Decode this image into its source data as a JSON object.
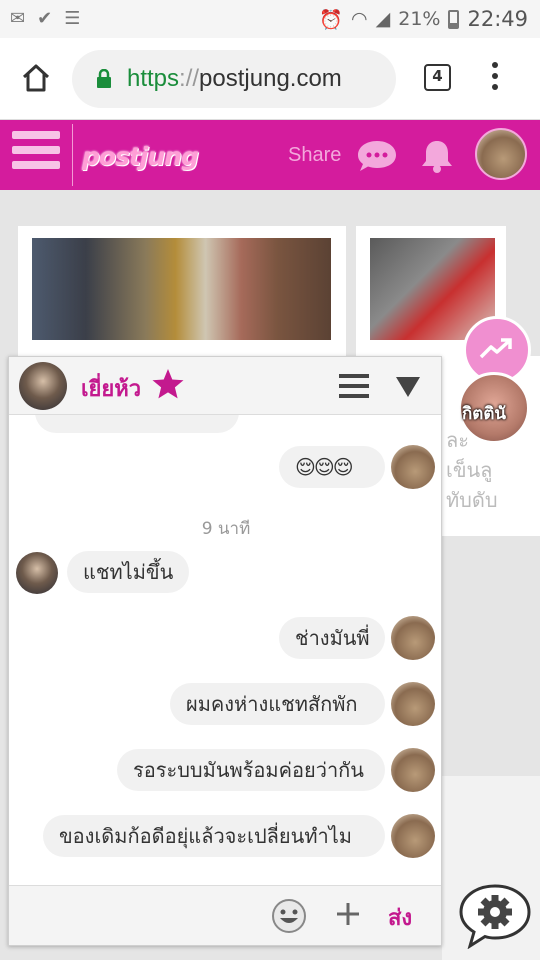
{
  "status_bar": {
    "battery": "21%",
    "time": "22:49"
  },
  "browser": {
    "url_scheme": "https",
    "url_sep": "://",
    "url_host": "postjung.com",
    "tab_count": "4"
  },
  "site": {
    "logo": "postjung",
    "share_label": "Share"
  },
  "side_user": {
    "name": "กิตตินั"
  },
  "background_text": [
    "ละ",
    "เข็นลู",
    "ทับดับ"
  ],
  "chat": {
    "contact_name": "เยี่ยห้ว",
    "timestamp": "9 นาที",
    "messages": [
      {
        "from": "me",
        "text": "😌😌😌"
      },
      {
        "from": "them",
        "text": "แชทไม่ขึ้น"
      },
      {
        "from": "me",
        "text": "ช่างมันพี่"
      },
      {
        "from": "me",
        "text": "ผมคงห่างแชทสักพัก"
      },
      {
        "from": "me",
        "text": "รอระบบมันพร้อมค่อยว่ากัน"
      },
      {
        "from": "me",
        "text": "ของเดิมก้อดีอยุ่แล้วจะเปลี่ยนทำไม"
      }
    ],
    "send_label": "ส่ง"
  },
  "colors": {
    "brand": "#d41c9d",
    "accent": "#c3198e"
  }
}
